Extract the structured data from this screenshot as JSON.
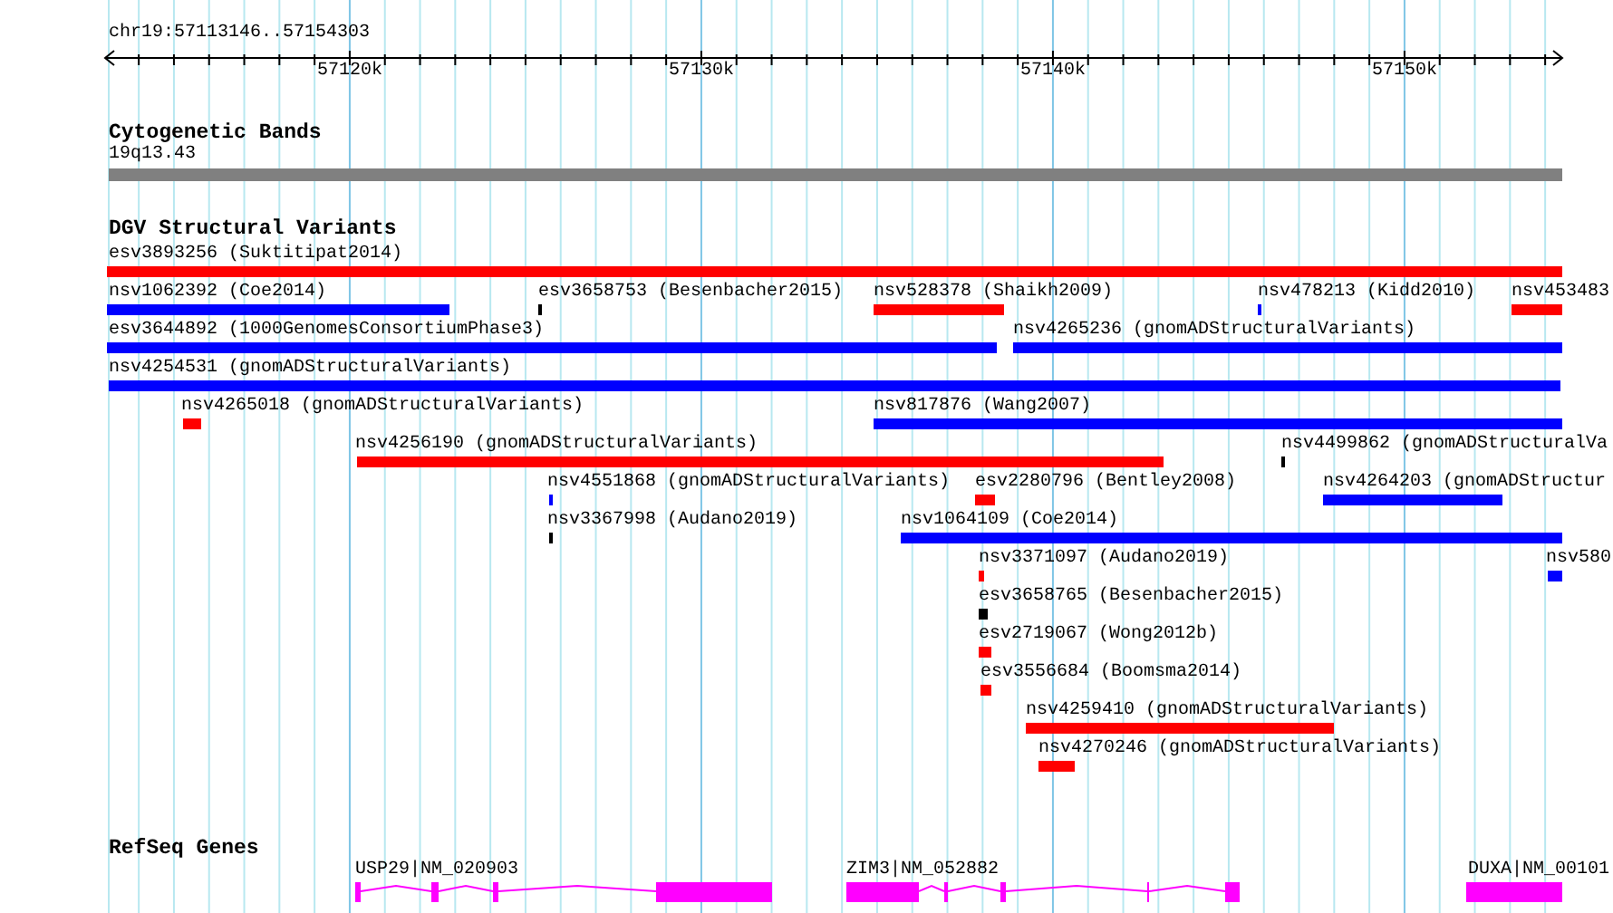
{
  "ruler": {
    "label": "chr19:57113146..57154303",
    "ticks": [
      "57120k",
      "57130k",
      "57140k",
      "57150k"
    ]
  },
  "tracks": [
    {
      "title": "Cytogenetic Bands",
      "kind": "bands",
      "features": [
        {
          "label": "19q13.43"
        }
      ]
    },
    {
      "title": "DGV Structural Variants",
      "kind": "variants",
      "features": [
        {
          "label": "esv3893256 (Suktitipat2014)",
          "color": "#ff0000"
        },
        {
          "label": "nsv1062392 (Coe2014)",
          "color": "#0000ff"
        },
        {
          "label": "esv3658753 (Besenbacher2015)",
          "color": "#000000"
        },
        {
          "label": "nsv528378 (Shaikh2009)",
          "color": "#ff0000"
        },
        {
          "label": "nsv478213 (Kidd2010)",
          "color": "#0000ff"
        },
        {
          "label": "nsv453483",
          "color": "#ff0000"
        },
        {
          "label": "esv3644892 (1000GenomesConsortiumPhase3)",
          "color": "#0000ff"
        },
        {
          "label": "nsv4265236 (gnomADStructuralVariants)",
          "color": "#0000ff"
        },
        {
          "label": "nsv4254531 (gnomADStructuralVariants)",
          "color": "#0000ff"
        },
        {
          "label": "nsv4265018 (gnomADStructuralVariants)",
          "color": "#ff0000"
        },
        {
          "label": "nsv817876 (Wang2007)",
          "color": "#0000ff"
        },
        {
          "label": "nsv4256190 (gnomADStructuralVariants)",
          "color": "#ff0000"
        },
        {
          "label": "nsv4499862 (gnomADStructuralVa",
          "color": "#000000"
        },
        {
          "label": "nsv4551868 (gnomADStructuralVariants)",
          "color": "#0000ff"
        },
        {
          "label": "esv2280796 (Bentley2008)",
          "color": "#ff0000"
        },
        {
          "label": "nsv4264203 (gnomADStructur",
          "color": "#0000ff"
        },
        {
          "label": "nsv3367998 (Audano2019)",
          "color": "#000000"
        },
        {
          "label": "nsv1064109 (Coe2014)",
          "color": "#0000ff"
        },
        {
          "label": "nsv3371097 (Audano2019)",
          "color": "#ff0000"
        },
        {
          "label": "nsv580",
          "color": "#0000ff"
        },
        {
          "label": "esv3658765 (Besenbacher2015)",
          "color": "#000000"
        },
        {
          "label": "esv2719067 (Wong2012b)",
          "color": "#ff0000"
        },
        {
          "label": "esv3556684 (Boomsma2014)",
          "color": "#ff0000"
        },
        {
          "label": "nsv4259410 (gnomADStructuralVariants)",
          "color": "#ff0000"
        },
        {
          "label": "nsv4270246 (gnomADStructuralVariants)",
          "color": "#ff0000"
        }
      ]
    },
    {
      "title": "RefSeq Genes",
      "kind": "genes",
      "features": [
        {
          "label": "USP29|NM_020903"
        },
        {
          "label": "ZIM3|NM_052882"
        },
        {
          "label": "DUXA|NM_00101"
        }
      ]
    }
  ]
}
